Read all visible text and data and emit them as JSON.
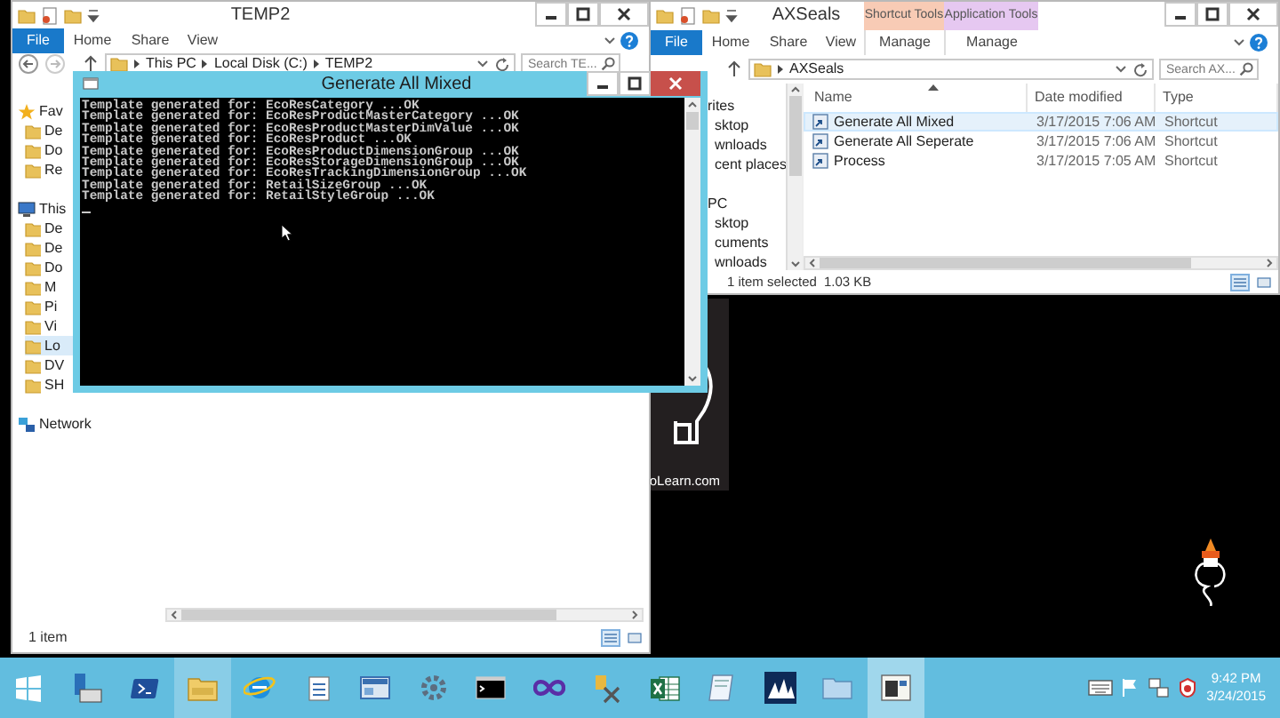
{
  "left_window": {
    "title": "TEMP2",
    "file_tab": "File",
    "tabs": [
      "Home",
      "Share",
      "View"
    ],
    "breadcrumbs": [
      "This PC",
      "Local Disk (C:)",
      "TEMP2"
    ],
    "search": {
      "placeholder": "Search TE..."
    },
    "nav": [
      {
        "label": "Fav",
        "selected": false,
        "children": [
          {
            "label": "De",
            "selected": false
          },
          {
            "label": "Do",
            "selected": false
          },
          {
            "label": "Re",
            "selected": false
          }
        ]
      },
      {
        "label": "This",
        "selected": false,
        "children": [
          {
            "label": "De",
            "selected": false
          },
          {
            "label": "De",
            "selected": false
          },
          {
            "label": "Do",
            "selected": false
          },
          {
            "label": "M",
            "selected": false
          },
          {
            "label": "Pi",
            "selected": false
          },
          {
            "label": "Vi",
            "selected": false
          },
          {
            "label": "Lo",
            "selected": true
          },
          {
            "label": "DV",
            "selected": false
          },
          {
            "label": "SH",
            "selected": false
          }
        ]
      },
      {
        "label": "Network",
        "selected": false
      }
    ],
    "status": "1 item"
  },
  "right_window": {
    "title": "AXSeals",
    "context_tabs": [
      {
        "group": "Shortcut Tools",
        "color": "#f8cbb5",
        "label": "Manage"
      },
      {
        "group": "Application Tools",
        "color": "#e6c8f1",
        "label": "Manage"
      }
    ],
    "file_tab": "File",
    "tabs": [
      "Home",
      "Share",
      "View"
    ],
    "breadcrumbs": [
      "AXSeals"
    ],
    "search": {
      "placeholder": "Search AX..."
    },
    "nav": [
      {
        "label": "rites",
        "selected": false,
        "children": [
          {
            "label": "sktop",
            "selected": false
          },
          {
            "label": "wnloads",
            "selected": false
          },
          {
            "label": "cent places",
            "selected": false
          }
        ]
      },
      {
        "label": "PC",
        "selected": false,
        "children": [
          {
            "label": "sktop",
            "selected": false
          },
          {
            "label": "cuments",
            "selected": false
          },
          {
            "label": "wnloads",
            "selected": false
          }
        ]
      }
    ],
    "columns": [
      "Name",
      "Date modified",
      "Type"
    ],
    "files": [
      {
        "name": "Generate All Mixed",
        "date": "3/17/2015 7:06 AM",
        "type": "Shortcut",
        "selected": true
      },
      {
        "name": "Generate All Seperate",
        "date": "3/17/2015 7:06 AM",
        "type": "Shortcut",
        "selected": false
      },
      {
        "name": "Process",
        "date": "3/17/2015 7:05 AM",
        "type": "Shortcut",
        "selected": false
      }
    ],
    "status": "1 item selected",
    "size": "1.03 KB"
  },
  "console": {
    "title": "Generate All Mixed",
    "lines": [
      "Template generated for: EcoResCategory ...OK",
      "Template generated for: EcoResProductMasterCategory ...OK",
      "Template generated for: EcoResProductMasterDimValue ...OK",
      "Template generated for: EcoResProduct ...OK",
      "Template generated for: EcoResProductDimensionGroup ...OK",
      "Template generated for: EcoResStorageDimensionGroup ...OK",
      "Template generated for: EcoResTrackingDimensionGroup ...OK",
      "Template generated for: RetailSizeGroup ...OK",
      "Template generated for: RetailStyleGroup ...OK"
    ]
  },
  "wallpaper": {
    "text": "oLearn.com"
  },
  "taskbar": {
    "time": "9:42 PM",
    "date": "3/24/2015"
  }
}
